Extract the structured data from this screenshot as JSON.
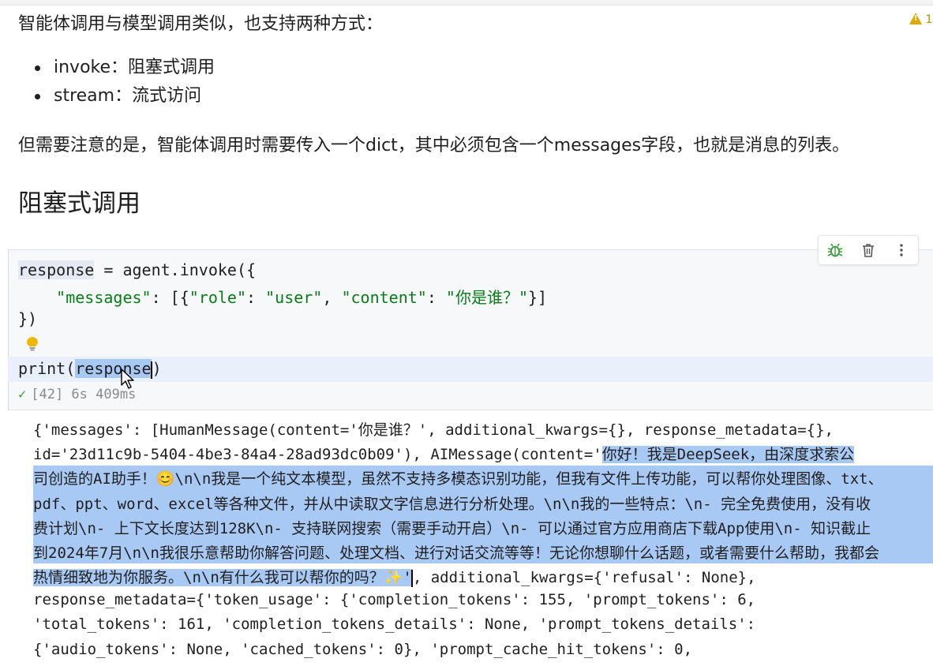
{
  "doc": {
    "intro": "智能体调用与模型调用类似，也支持两种方式：",
    "bullets": [
      "invoke：阻塞式调用",
      "stream：流式访问"
    ],
    "note": "但需要注意的是，智能体调用时需要传入一个dict，其中必须包含一个messages字段，也就是消息的列表。",
    "heading": "阻塞式调用",
    "warning_count": "1"
  },
  "toolbar": {
    "icons": [
      "bug-icon",
      "trash-icon",
      "more-vert-icon"
    ]
  },
  "code": {
    "line1_var": "response",
    "line1_rest": " = agent.invoke({",
    "line2_indent": "    ",
    "line2_key": "\"messages\"",
    "line2_mid1": ": [{",
    "line2_role_k": "\"role\"",
    "line2_colon1": ": ",
    "line2_role_v": "\"user\"",
    "line2_comma": ", ",
    "line2_content_k": "\"content\"",
    "line2_colon2": ": ",
    "line2_content_v": "\"你是谁？\"",
    "line2_end": "}]",
    "line3": "})",
    "line5_pre": "print(",
    "line5_sel": "response",
    "line5_post": ")",
    "status": "[42] 6s 409ms"
  },
  "output": {
    "o1": "{'messages': [HumanMessage(content='你是谁？', additional_kwargs={}, response_metadata={},",
    "o2_plain": "id='23d11c9b-5404-4be3-84a4-28ad93dc0b09'), AIMessage(content='",
    "o2_sel": "你好！我是DeepSeek，由深度求索公",
    "o3": "司创造的AI助手！😊\\n\\n我是一个纯文本模型，虽然不支持多模态识别功能，但我有文件上传功能，可以帮你处理图像、txt、",
    "o4": "pdf、ppt、word、excel等各种文件，并从中读取文字信息进行分析处理。\\n\\n我的一些特点：\\n- 完全免费使用，没有收",
    "o5": "费计划\\n- 上下文长度达到128K\\n- 支持联网搜索（需要手动开启）\\n- 可以通过官方应用商店下载App使用\\n- 知识截止",
    "o6": "到2024年7月\\n\\n我很乐意帮助你解答问题、处理文档、进行对话交流等等！无论你想聊什么话题，或者需要什么帮助，我都会",
    "o7_sel": "热情细致地为你服务。\\n\\n有什么我可以帮你的吗？✨'",
    "o7_plain": ", additional_kwargs={'refusal': None},",
    "o8": "response_metadata={'token_usage': {'completion_tokens': 155, 'prompt_tokens': 6,",
    "o9": "'total_tokens': 161, 'completion_tokens_details': None, 'prompt_tokens_details':",
    "o10": "{'audio_tokens': None, 'cached_tokens': 0}, 'prompt_cache_hit_tokens': 0,"
  }
}
